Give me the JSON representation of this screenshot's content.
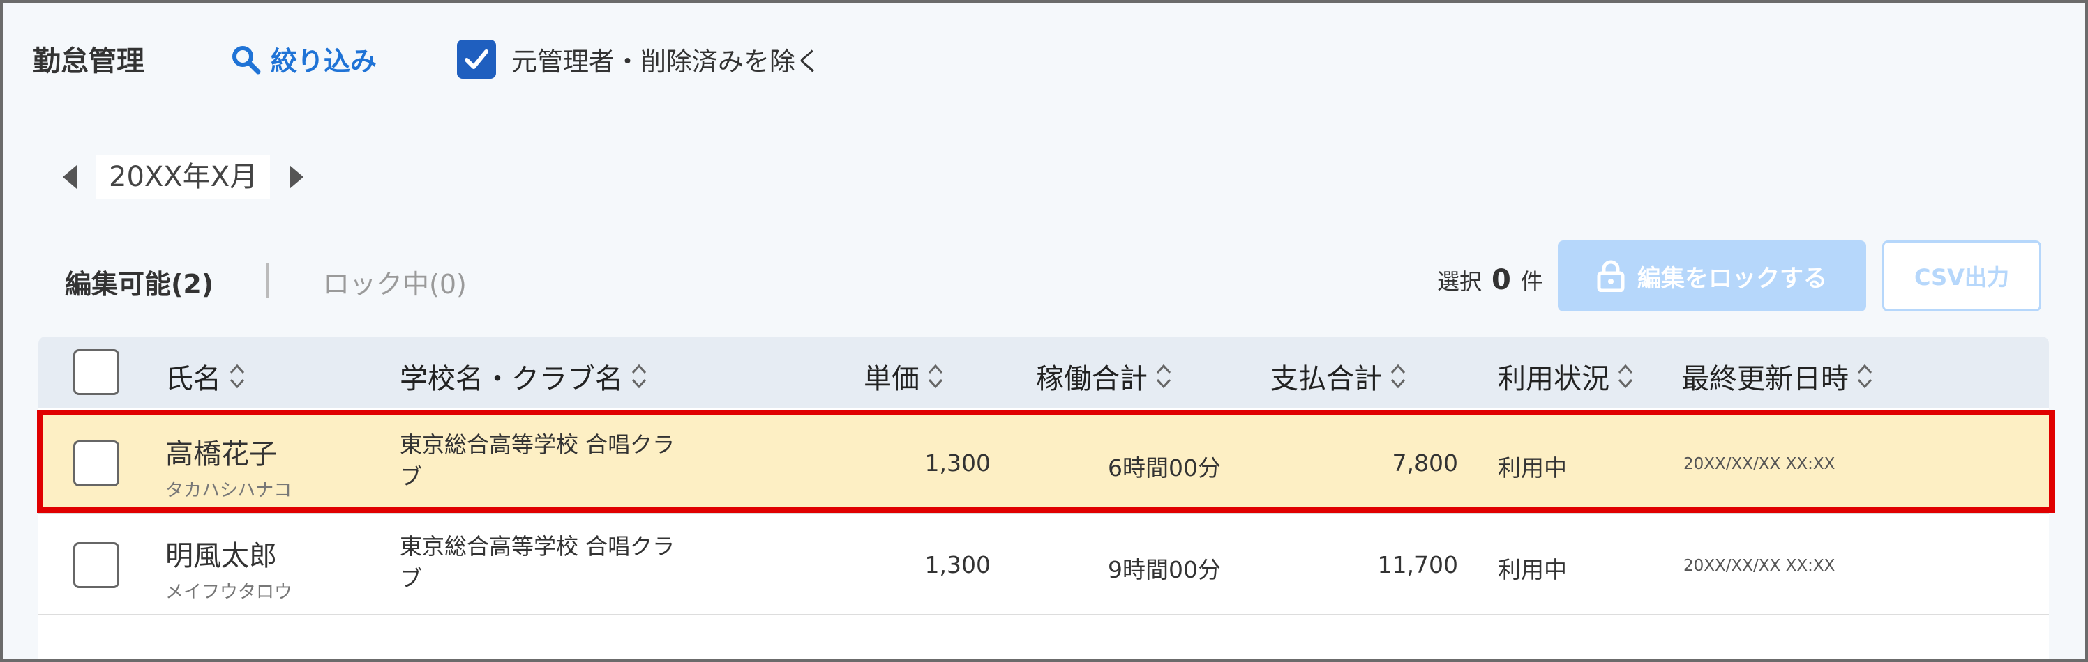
{
  "header": {
    "title": "勤怠管理",
    "filter_label": "絞り込み",
    "exclude_label": "元管理者・削除済みを除く",
    "exclude_checked": true
  },
  "month_nav": {
    "label": "20XX年X月"
  },
  "tabs": {
    "editable": "編集可能(2)",
    "locked": "ロック中(0)"
  },
  "selection": {
    "prefix": "選択",
    "count": "0",
    "suffix": "件"
  },
  "actions": {
    "lock_label": "編集をロックする",
    "csv_label": "CSV出力"
  },
  "table": {
    "columns": [
      "氏名",
      "学校名・クラブ名",
      "単価",
      "稼働合計",
      "支払合計",
      "利用状況",
      "最終更新日時"
    ],
    "rows": [
      {
        "name": "高橋花子",
        "kana": "タカハシハナコ",
        "school_line1": "東京総合高等学校 合唱クラ",
        "school_line2": "ブ",
        "unit_price": "1,300",
        "work_total": "6時間00分",
        "pay_total": "7,800",
        "status": "利用中",
        "updated": "20XX/XX/XX XX:XX",
        "highlighted": true
      },
      {
        "name": "明風太郎",
        "kana": "メイフウタロウ",
        "school_line1": "東京総合高等学校 合唱クラ",
        "school_line2": "ブ",
        "unit_price": "1,300",
        "work_total": "9時間00分",
        "pay_total": "11,700",
        "status": "利用中",
        "updated": "20XX/XX/XX XX:XX",
        "highlighted": false
      }
    ]
  },
  "colors": {
    "accent": "#1f73d6",
    "checkbox": "#1f5fbf",
    "disabled_button": "#b6d7fb",
    "highlight_row": "#fdefc4",
    "annotation": "#e00000"
  }
}
